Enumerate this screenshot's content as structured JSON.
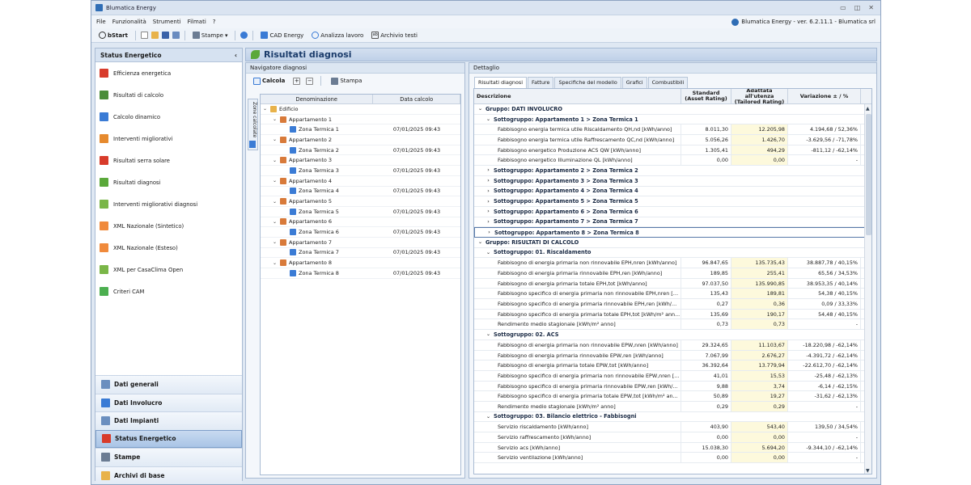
{
  "window": {
    "title": "Blumatica Energy"
  },
  "menu": [
    "File",
    "Funzionalità",
    "Strumenti",
    "Filmati",
    "?"
  ],
  "version": "Blumatica Energy - ver. 6.2.11.1 - Blumatica srl",
  "toolbar": {
    "bstart": "bStart",
    "stampe": "Stampe",
    "cad": "CAD Energy",
    "analizza": "Analizza lavoro",
    "archivio": "Archivio testi"
  },
  "sidebar": {
    "header": "Status Energetico",
    "collapse": "‹",
    "items": [
      {
        "label": "Efficienza energetica",
        "icon": "energy-class-icon",
        "color": "#d83b2b"
      },
      {
        "label": "Risultati di calcolo",
        "icon": "results-icon",
        "color": "#4b8d3a"
      },
      {
        "label": "Calcolo dinamico",
        "icon": "wave-chart-icon",
        "color": "#3a7bd5"
      },
      {
        "label": "Interventi migliorativi",
        "icon": "improvements-icon",
        "color": "#e68a2e"
      },
      {
        "label": "Risultati serra solare",
        "icon": "greenhouse-icon",
        "color": "#d83b2b"
      },
      {
        "label": "Risultati diagnosi",
        "icon": "leaf-icon",
        "color": "#5aa83a"
      },
      {
        "label": "Interventi migliorativi diagnosi",
        "icon": "leaf-gear-icon",
        "color": "#7ab648"
      },
      {
        "label": "XML Nazionale (Sintetico)",
        "icon": "xml-icon",
        "color": "#f08a3c"
      },
      {
        "label": "XML Nazionale (Esteso)",
        "icon": "xml-icon",
        "color": "#f08a3c"
      },
      {
        "label": "XML per CasaClima Open",
        "icon": "casaclima-icon",
        "color": "#7ab648"
      },
      {
        "label": "Criteri CAM",
        "icon": "recycle-icon",
        "color": "#4caf50"
      }
    ],
    "nav": [
      {
        "label": "Dati generali",
        "icon": "general-data-icon",
        "color": "#6b8fbf"
      },
      {
        "label": "Dati Involucro",
        "icon": "building-envelope-icon",
        "color": "#3a7bd5"
      },
      {
        "label": "Dati Impianti",
        "icon": "systems-icon",
        "color": "#6b8fbf"
      },
      {
        "label": "Status Energetico",
        "icon": "energy-status-icon",
        "color": "#d83b2b",
        "active": true
      },
      {
        "label": "Stampe",
        "icon": "printer-icon",
        "color": "#6b7c93"
      },
      {
        "label": "Archivi di base",
        "icon": "archive-folder-icon",
        "color": "#e8b24a"
      }
    ]
  },
  "main": {
    "title": "Risultati diagnosi"
  },
  "navigator": {
    "title": "Navigatore diagnosi",
    "calcola": "Calcola",
    "stampa": "Stampa",
    "vtab": "Zone calcolate",
    "col_name": "Denominazione",
    "col_date": "Data calcolo",
    "rows": [
      {
        "name": "Edificio",
        "level": 0,
        "type": "building",
        "date": ""
      },
      {
        "name": "Appartamento 1",
        "level": 1,
        "type": "apt",
        "date": ""
      },
      {
        "name": "Zona Termica 1",
        "level": 2,
        "type": "zone",
        "date": "07/01/2025 09:43"
      },
      {
        "name": "Appartamento 2",
        "level": 1,
        "type": "apt",
        "date": ""
      },
      {
        "name": "Zona Termica 2",
        "level": 2,
        "type": "zone",
        "date": "07/01/2025 09:43"
      },
      {
        "name": "Appartamento 3",
        "level": 1,
        "type": "apt",
        "date": ""
      },
      {
        "name": "Zona Termica 3",
        "level": 2,
        "type": "zone",
        "date": "07/01/2025 09:43"
      },
      {
        "name": "Appartamento 4",
        "level": 1,
        "type": "apt",
        "date": ""
      },
      {
        "name": "Zona Termica 4",
        "level": 2,
        "type": "zone",
        "date": "07/01/2025 09:43"
      },
      {
        "name": "Appartamento 5",
        "level": 1,
        "type": "apt",
        "date": ""
      },
      {
        "name": "Zona Termica 5",
        "level": 2,
        "type": "zone",
        "date": "07/01/2025 09:43"
      },
      {
        "name": "Appartamento 6",
        "level": 1,
        "type": "apt",
        "date": ""
      },
      {
        "name": "Zona Termica 6",
        "level": 2,
        "type": "zone",
        "date": "07/01/2025 09:43"
      },
      {
        "name": "Appartamento 7",
        "level": 1,
        "type": "apt",
        "date": ""
      },
      {
        "name": "Zona Termica 7",
        "level": 2,
        "type": "zone",
        "date": "07/01/2025 09:43"
      },
      {
        "name": "Appartamento 8",
        "level": 1,
        "type": "apt",
        "date": ""
      },
      {
        "name": "Zona Termica 8",
        "level": 2,
        "type": "zone",
        "date": "07/01/2025 09:43"
      }
    ]
  },
  "detail": {
    "title": "Dettaglio",
    "tabs": [
      "Risultati diagnosi",
      "Fatture",
      "Specifiche del modello",
      "Grafici",
      "Combustibili"
    ],
    "headers": {
      "desc": "Descrizione",
      "std1": "Standard",
      "std2": "(Asset Rating)",
      "ada1": "Adattata all'utenza",
      "ada2": "(Tailored Rating)",
      "var": "Variazione ± / %"
    },
    "rows": [
      {
        "k": "g",
        "t": "Gruppo: DATI INVOLUCRO"
      },
      {
        "k": "s",
        "t": "Sottogruppo: Appartamento 1 > Zona Termica 1",
        "open": true
      },
      {
        "k": "r",
        "t": "Fabbisogno energia termica utile Riscaldamento QH,nd [kWh/anno]",
        "a": "8.011,30",
        "b": "12.205,98",
        "c": "4.194,68 / 52,36%"
      },
      {
        "k": "r",
        "t": "Fabbisogno energia termica utile Raffrescamento QC,nd [kWh/anno]",
        "a": "5.056,26",
        "b": "1.426,70",
        "c": "-3.629,56 / -71,78%"
      },
      {
        "k": "r",
        "t": "Fabbisogno energetico Produzione ACS QW [kWh/anno]",
        "a": "1.305,41",
        "b": "494,29",
        "c": "-811,12 / -62,14%"
      },
      {
        "k": "r",
        "t": "Fabbisogno energetico Illuminazione QL [kWh/anno]",
        "a": "0,00",
        "b": "0,00",
        "c": "-"
      },
      {
        "k": "s",
        "t": "Sottogruppo: Appartamento 2 > Zona Termica 2"
      },
      {
        "k": "s",
        "t": "Sottogruppo: Appartamento 3 > Zona Termica 3"
      },
      {
        "k": "s",
        "t": "Sottogruppo: Appartamento 4 > Zona Termica 4"
      },
      {
        "k": "s",
        "t": "Sottogruppo: Appartamento 5 > Zona Termica 5"
      },
      {
        "k": "s",
        "t": "Sottogruppo: Appartamento 6 > Zona Termica 6"
      },
      {
        "k": "s",
        "t": "Sottogruppo: Appartamento 7 > Zona Termica 7"
      },
      {
        "k": "s",
        "t": "Sottogruppo: Appartamento 8 > Zona Termica 8",
        "sel": true
      },
      {
        "k": "g",
        "t": "Gruppo: RISULTATI DI CALCOLO"
      },
      {
        "k": "s",
        "t": "Sottogruppo: 01. Riscaldamento",
        "open": true
      },
      {
        "k": "r",
        "t": "Fabbisogno di energia primaria non rinnovabile EPH,nren [kWh/anno]",
        "a": "96.847,65",
        "b": "135.735,43",
        "c": "38.887,78 / 40,15%"
      },
      {
        "k": "r",
        "t": "Fabbisogno di energia primaria rinnovabile EPH,ren [kWh/anno]",
        "a": "189,85",
        "b": "255,41",
        "c": "65,56 / 34,53%"
      },
      {
        "k": "r",
        "t": "Fabbisogno di energia primaria totale EPH,tot [kWh/anno]",
        "a": "97.037,50",
        "b": "135.990,85",
        "c": "38.953,35 / 40,14%"
      },
      {
        "k": "r",
        "t": "Fabbisogno specifico di energia primaria non rinnovabile EPH,nren [k...",
        "a": "135,43",
        "b": "189,81",
        "c": "54,38 / 40,15%"
      },
      {
        "k": "r",
        "t": "Fabbisogno specifico di energia primaria rinnovabile EPH,ren [kWh/m...",
        "a": "0,27",
        "b": "0,36",
        "c": "0,09 / 33,33%"
      },
      {
        "k": "r",
        "t": "Fabbisogno specifico di energia primaria totale EPH,tot [kWh/m² ann...",
        "a": "135,69",
        "b": "190,17",
        "c": "54,48 / 40,15%"
      },
      {
        "k": "r",
        "t": "Rendimento medio stagionale [kWh/m² anno]",
        "a": "0,73",
        "b": "0,73",
        "c": "-"
      },
      {
        "k": "s",
        "t": "Sottogruppo: 02. ACS",
        "open": true
      },
      {
        "k": "r",
        "t": "Fabbisogno di energia primaria non rinnovabile EPW,nren [kWh/anno]",
        "a": "29.324,65",
        "b": "11.103,67",
        "c": "-18.220,98 / -62,14%"
      },
      {
        "k": "r",
        "t": "Fabbisogno di energia primaria rinnovabile EPW,ren [kWh/anno]",
        "a": "7.067,99",
        "b": "2.676,27",
        "c": "-4.391,72 / -62,14%"
      },
      {
        "k": "r",
        "t": "Fabbisogno di energia primaria totale EPW,tot [kWh/anno]",
        "a": "36.392,64",
        "b": "13.779,94",
        "c": "-22.612,70 / -62,14%"
      },
      {
        "k": "r",
        "t": "Fabbisogno specifico di energia primaria non rinnovabile EPW,nren [...",
        "a": "41,01",
        "b": "15,53",
        "c": "-25,48 / -62,13%"
      },
      {
        "k": "r",
        "t": "Fabbisogno specifico di energia primaria rinnovabile EPW,ren [kWh/...",
        "a": "9,88",
        "b": "3,74",
        "c": "-6,14 / -62,15%"
      },
      {
        "k": "r",
        "t": "Fabbisogno specifico di energia primaria totale EPW,tot [kWh/m² an...",
        "a": "50,89",
        "b": "19,27",
        "c": "-31,62 / -62,13%"
      },
      {
        "k": "r",
        "t": "Rendimento medio stagionale [kWh/m² anno]",
        "a": "0,29",
        "b": "0,29",
        "c": "-"
      },
      {
        "k": "s",
        "t": "Sottogruppo: 03. Bilancio elettrico - Fabbisogni",
        "open": true
      },
      {
        "k": "r",
        "t": "Servizio riscaldamento [kWh/anno]",
        "a": "403,90",
        "b": "543,40",
        "c": "139,50 / 34,54%"
      },
      {
        "k": "r",
        "t": "Servizio raffrescamento [kWh/anno]",
        "a": "0,00",
        "b": "0,00",
        "c": "-"
      },
      {
        "k": "r",
        "t": "Servizio acs [kWh/anno]",
        "a": "15.038,30",
        "b": "5.694,20",
        "c": "-9.344,10 / -62,14%"
      },
      {
        "k": "r",
        "t": "Servizio ventilazione [kWh/anno]",
        "a": "0,00",
        "b": "0,00",
        "c": "-"
      }
    ]
  }
}
